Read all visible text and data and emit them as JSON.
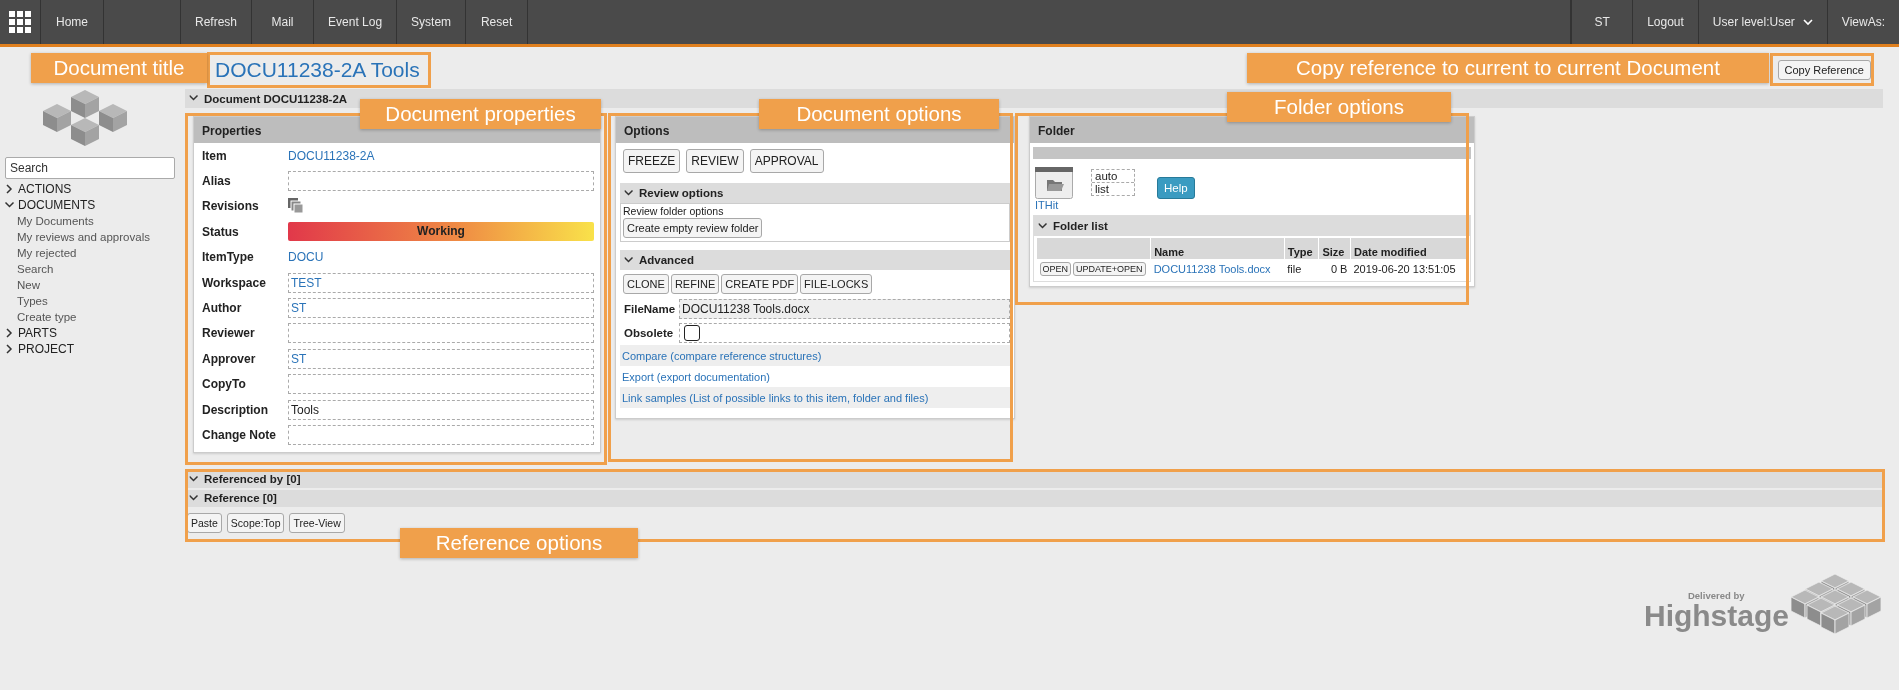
{
  "nav": {
    "left": [
      {
        "label": "Home"
      },
      {
        "label": "Refresh"
      },
      {
        "label": "Mail"
      },
      {
        "label": "Event Log"
      },
      {
        "label": "System"
      },
      {
        "label": "Reset"
      }
    ],
    "right": [
      {
        "label": "ST",
        "kind": "plain"
      },
      {
        "label": "Logout",
        "kind": "plain"
      },
      {
        "label": "User level:User",
        "kind": "dropdown"
      },
      {
        "label": "ViewAs:",
        "kind": "plain"
      }
    ]
  },
  "title": "DOCU11238-2A Tools",
  "copy_button": "Copy Reference",
  "sidebar": {
    "search_placeholder": "Search",
    "tree": [
      {
        "label": "ACTIONS",
        "expanded": false
      },
      {
        "label": "DOCUMENTS",
        "expanded": true,
        "children": [
          {
            "label": "My Documents"
          },
          {
            "label": "My reviews and approvals"
          },
          {
            "label": "My rejected"
          },
          {
            "label": "Search"
          },
          {
            "label": "New"
          },
          {
            "label": "Types"
          },
          {
            "label": "Create type"
          }
        ]
      },
      {
        "label": "PARTS",
        "expanded": false
      },
      {
        "label": "PROJECT",
        "expanded": false
      }
    ]
  },
  "document_header": {
    "title": "Document DOCU11238-2A",
    "expanded": true
  },
  "properties": {
    "title": "Properties",
    "rows": [
      {
        "label": "Item",
        "kind": "link",
        "value": "DOCU11238-2A"
      },
      {
        "label": "Alias",
        "kind": "field"
      },
      {
        "label": "Revisions",
        "kind": "revisions"
      },
      {
        "label": "Status",
        "kind": "status",
        "value": "Working"
      },
      {
        "label": "ItemType",
        "kind": "link",
        "value": "DOCU"
      },
      {
        "label": "Workspace",
        "kind": "field",
        "value": "TEST",
        "linked": true
      },
      {
        "label": "Author",
        "kind": "field",
        "value": "ST",
        "linked": true
      },
      {
        "label": "Reviewer",
        "kind": "field"
      },
      {
        "label": "Approver",
        "kind": "field",
        "value": "ST",
        "linked": true
      },
      {
        "label": "CopyTo",
        "kind": "field"
      },
      {
        "label": "Description",
        "kind": "field",
        "value": "Tools",
        "linked": false
      },
      {
        "label": "Change Note",
        "kind": "field"
      }
    ]
  },
  "options": {
    "title": "Options",
    "buttons": [
      "FREEZE",
      "REVIEW",
      "APPROVAL"
    ],
    "review": {
      "title": "Review options",
      "expanded": true,
      "text": "Review folder options",
      "button": "Create empty review folder"
    },
    "advanced": {
      "title": "Advanced",
      "expanded": true,
      "buttons": [
        "CLONE",
        "REFINE",
        "CREATE PDF",
        "FILE-LOCKS"
      ],
      "fields": [
        {
          "label": "FileName",
          "kind": "text",
          "value": "DOCU11238 Tools.docx"
        },
        {
          "label": "Obsolete",
          "kind": "checkbox",
          "checked": false
        }
      ]
    },
    "links": [
      "Compare (compare reference structures)",
      "Export (export documentation)",
      "Link samples (List of possible links to this item, folder and files)"
    ]
  },
  "folder": {
    "title": "Folder",
    "icon_label": "ITHit",
    "views": [
      "auto",
      "list"
    ],
    "help": "Help",
    "list": {
      "title": "Folder list",
      "expanded": true,
      "columns": [
        "Name",
        "Type",
        "Size",
        "Date modified"
      ],
      "rows": [
        {
          "actions": [
            "OPEN",
            "UPDATE+OPEN"
          ],
          "name": "DOCU11238 Tools.docx",
          "type": "file",
          "size": "0 B",
          "date": "2019-06-20 13:51:05"
        }
      ]
    }
  },
  "references": {
    "sections": [
      {
        "title": "Referenced by [0]",
        "expanded": true
      },
      {
        "title": "Reference [0]",
        "expanded": true
      }
    ],
    "buttons": [
      "Paste",
      "Scope:Top",
      "Tree-View"
    ]
  },
  "footer": {
    "delivered_by": "Delivered by",
    "brand": "Highstage"
  },
  "annotations": [
    {
      "label": "Document title"
    },
    {
      "label": "Document properties"
    },
    {
      "label": "Document options"
    },
    {
      "label": "Folder options"
    },
    {
      "label": "Copy reference to current to current Document"
    },
    {
      "label": "Reference options"
    }
  ]
}
